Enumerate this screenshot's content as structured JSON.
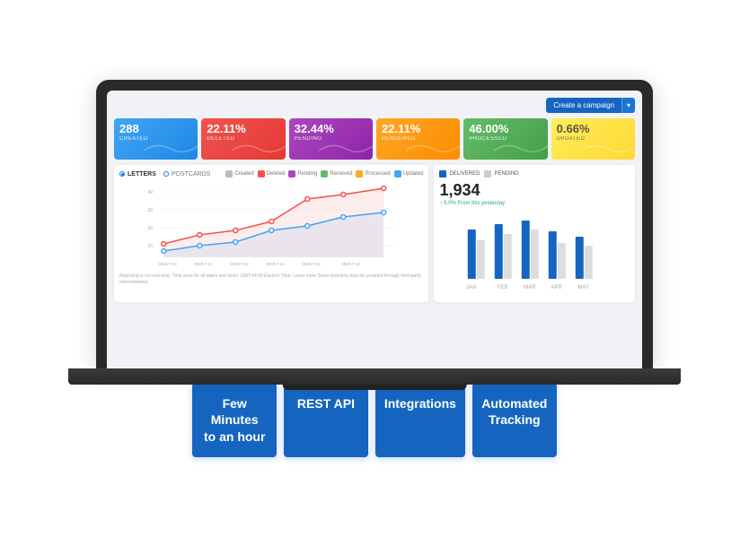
{
  "dashboard": {
    "create_btn": "Create a campaign",
    "create_btn_arrow": "▾",
    "stat_cards": [
      {
        "num": "288",
        "label": "CREATED",
        "class": "card-blue"
      },
      {
        "num": "22.11%",
        "label": "DELETED",
        "class": "card-red"
      },
      {
        "num": "32.44%",
        "label": "PENDING",
        "class": "card-purple"
      },
      {
        "num": "22.11%",
        "label": "RENDERED",
        "class": "card-orange"
      },
      {
        "num": "46.00%",
        "label": "PROCESSED",
        "class": "card-green"
      },
      {
        "num": "0.66%",
        "label": "UPDATED",
        "class": "card-yellow"
      }
    ],
    "left_panel": {
      "tab1": "LETTERS",
      "tab2": "POSTCARDS",
      "legend": [
        {
          "label": "Created",
          "color": "#bbb"
        },
        {
          "label": "Deleted",
          "color": "#ef5350"
        },
        {
          "label": "Pending",
          "color": "#ab47bc"
        },
        {
          "label": "Received",
          "color": "#66bb6a"
        },
        {
          "label": "Processed",
          "color": "#ffa726"
        },
        {
          "label": "Updated",
          "color": "#42a5f5"
        }
      ],
      "footer": "Reporting is not real-time. Time zone for all dates and times: GMT-04:00 Eastern Time. Learn more\nSome inventory may be provided through third-party intermediaries."
    },
    "right_panel": {
      "legend": [
        {
          "label": "DELIVERED",
          "color": "#1565c0"
        },
        {
          "label": "PENDING",
          "color": "#ccc"
        }
      ],
      "big_number": "1,934",
      "big_number_sub": "↑ 5.0% From this yesterday",
      "months": [
        "JAN",
        "FEB",
        "MAR",
        "APR",
        "MAY"
      ],
      "bars": [
        {
          "delivered": 75,
          "pending": 55
        },
        {
          "delivered": 80,
          "pending": 60
        },
        {
          "delivered": 85,
          "pending": 65
        },
        {
          "delivered": 70,
          "pending": 50
        },
        {
          "delivered": 60,
          "pending": 45
        }
      ]
    }
  },
  "features": [
    {
      "label": "Few Minutes\nto an hour"
    },
    {
      "label": "REST API"
    },
    {
      "label": "Integrations"
    },
    {
      "label": "Automated\nTracking"
    }
  ]
}
